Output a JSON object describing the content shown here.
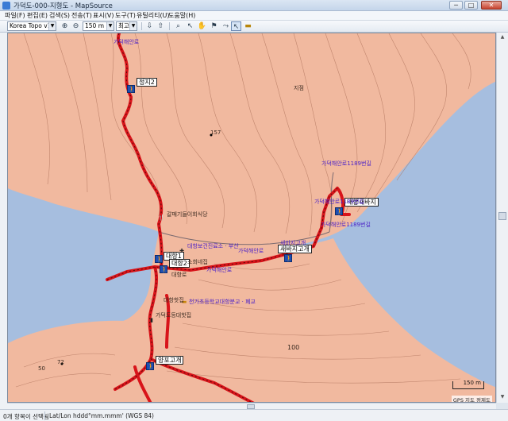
{
  "window": {
    "title": "가덕도-000-지형도 - MapSource",
    "minimize": "─",
    "maximize": "□",
    "close": "✕"
  },
  "menu": [
    "파일(F)",
    "편집(E)",
    "검색(S)",
    "전송(T)",
    "표시(V)",
    "도구(T)",
    "유틸리티(U)",
    "도움말(H)"
  ],
  "toolbar": {
    "product": "Korea Topo v1.1",
    "zoom_in": "⊕",
    "zoom_out": "⊖",
    "zoom_scale": "150 m",
    "detail": "최고",
    "icons": [
      "receive-from-device-icon",
      "send-to-device-icon",
      "zoom-tool-icon",
      "select-tool-icon",
      "pan-tool-icon",
      "waypoint-tool-icon",
      "route-tool-icon",
      "pointer-tool-icon",
      "track-tool-icon",
      "measure-tool-icon"
    ]
  },
  "map": {
    "colors": {
      "water": "#a6bedf",
      "land": "#f1b99f",
      "contour": "#b0745d",
      "track": "#d8141a",
      "label": "#4b22c7"
    },
    "waypoints": [
      {
        "name": "정지2"
      },
      {
        "name": "대항새바지"
      },
      {
        "name": "새바지고개"
      },
      {
        "name": "대항1"
      },
      {
        "name": "대항2"
      },
      {
        "name": "양포고개"
      }
    ],
    "labels": {
      "road_top": "가덕해안로",
      "elev_157": "157",
      "place_top": "지점",
      "restaurant": "갈매기들이회식당",
      "clinic": "대항보건진료소 · 부산",
      "store": "소희네집",
      "road_mid": "가덕해안로",
      "road_mid2": "가덕해안로",
      "school": "천가초등학교대항분교 · 폐교",
      "village": "대항핫집",
      "village2": "가덕도등대핫집",
      "road_east": "가덕해안로1189번길",
      "road_east2": "가덕해안로1189번길",
      "road_east3": "가덕해안로1189번길",
      "road_pass": "새바지고개",
      "elev_100": "100",
      "elev_72": "72",
      "elev_50": "50",
      "road_vert": "대항로"
    },
    "scale_bar": "150 m",
    "credit": "GPS 지도 정제도"
  },
  "status": {
    "selection": "0개 항목이 선택됨",
    "coord_format": "Lat/Lon hddd°mm.mmm' (WGS 84)"
  }
}
